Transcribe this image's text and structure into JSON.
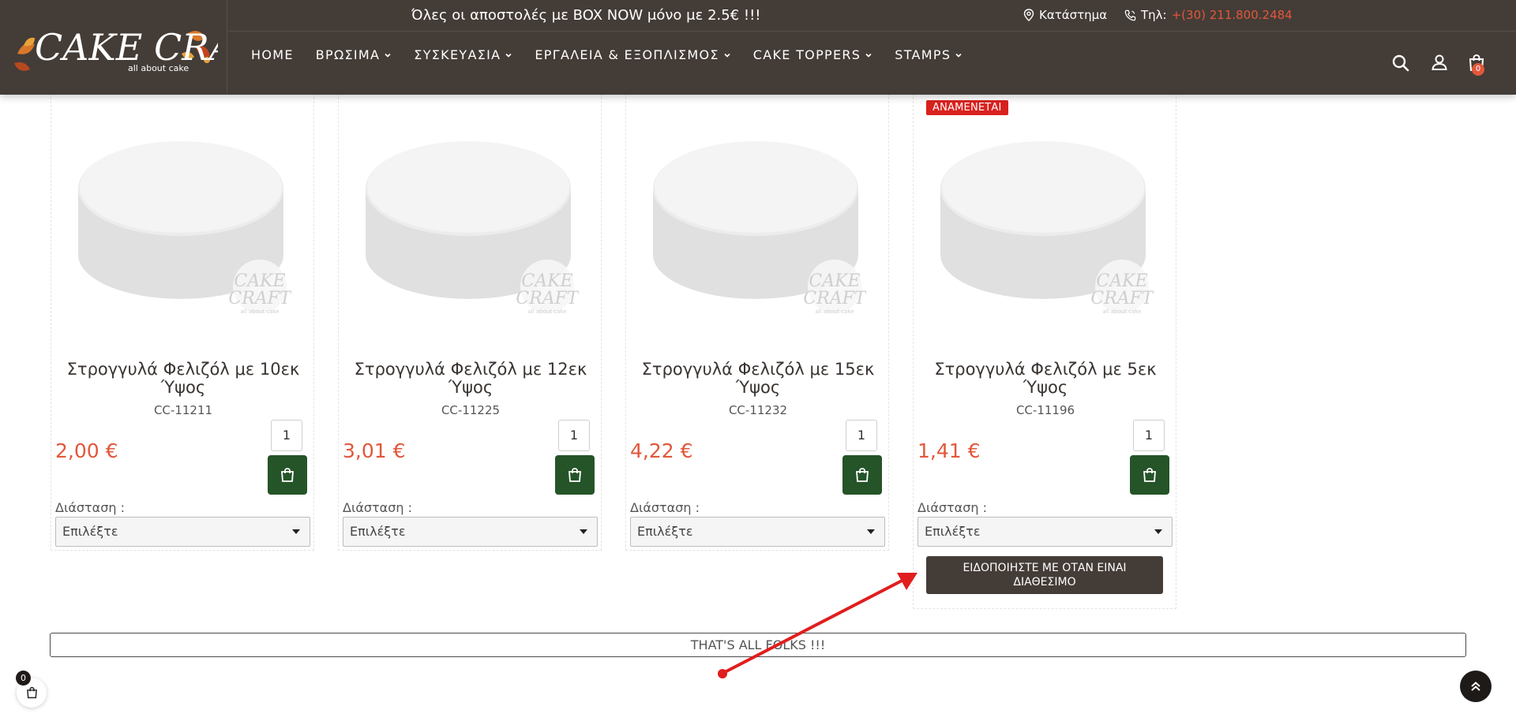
{
  "header": {
    "promo": "Όλες οι αποστολές με BOX NOW μόνο με 2.5€ !!!",
    "store_label": "Κατάστημα",
    "phone_prefix": "Τηλ:",
    "phone_number": "+(30) 211.800.2484",
    "logo_text": "CAKE CRAFT",
    "logo_tagline": "all about cake",
    "nav": [
      {
        "label": "HOME"
      },
      {
        "label": "ΒΡΩΣΙΜΑ"
      },
      {
        "label": "ΣΥΣΚΕΥΑΣΙΑ"
      },
      {
        "label": "ΕΡΓΑΛΕΙΑ & ΕΞΟΠΛΙΣΜΟΣ"
      },
      {
        "label": "CAKE TOPPERS"
      },
      {
        "label": "STAMPS"
      }
    ],
    "cart_count": "0",
    "icons": [
      "search-icon",
      "user-icon",
      "bag-icon"
    ]
  },
  "products": [
    {
      "title": "Στρογγυλά Φελιζόλ με 10εκ Ύψος",
      "sku": "CC-11211",
      "qty": "1",
      "price": "2,00 €",
      "dimension_label": "Διάσταση :",
      "select_value": "Επιλέξτε"
    },
    {
      "title": "Στρογγυλά Φελιζόλ με 12εκ Ύψος",
      "sku": "CC-11225",
      "qty": "1",
      "price": "3,01 €",
      "dimension_label": "Διάσταση :",
      "select_value": "Επιλέξτε"
    },
    {
      "title": "Στρογγυλά Φελιζόλ με 15εκ Ύψος",
      "sku": "CC-11232",
      "qty": "1",
      "price": "4,22 €",
      "dimension_label": "Διάσταση :",
      "select_value": "Επιλέξτε"
    },
    {
      "title": "Στρογγυλά Φελιζόλ με 5εκ Ύψος",
      "sku": "CC-11196",
      "qty": "1",
      "price": "1,41 €",
      "dimension_label": "Διάσταση :",
      "select_value": "Επιλέξτε",
      "badge": "ΑΝΑΜΕΝΕΤΑΙ",
      "notify_label": "ΕΙΔΟΠΟΙΗΣΤΕ ΜΕ ΟΤΑΝ ΕΙΝΑΙ ΔΙΑΘΕΣΙΜΟ"
    }
  ],
  "watermark": {
    "line1": "CAKE",
    "line2": "CRAFT",
    "line3": "all about cake"
  },
  "footer": {
    "end_message": "THAT'S ALL FOLKS !!!",
    "mini_cart_count": "0"
  },
  "colors": {
    "header_bg": "#443c37",
    "accent": "#e2573b",
    "cart_button": "#255428",
    "badge_red": "#d9221e",
    "annotation_arrow": "#e01e1e"
  }
}
